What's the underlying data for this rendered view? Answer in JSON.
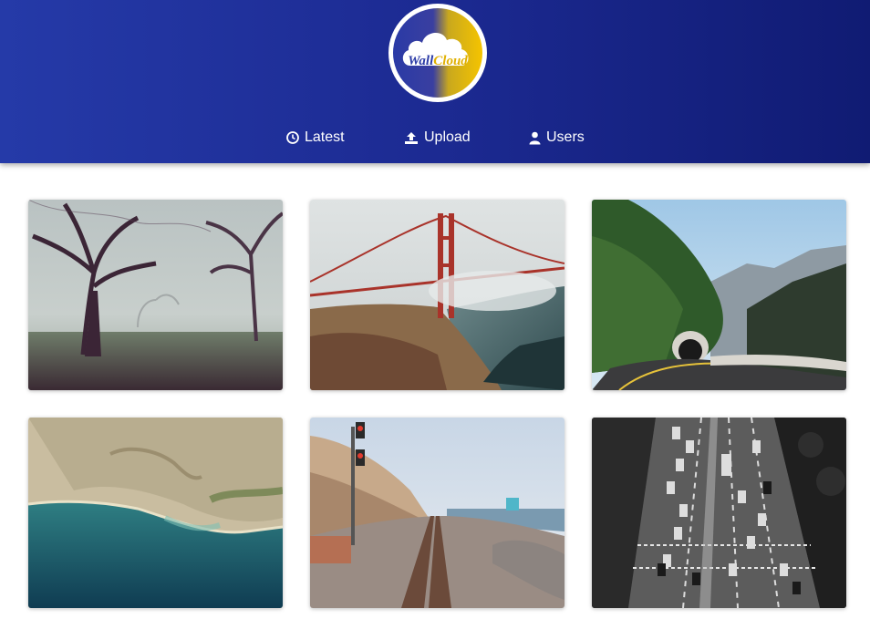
{
  "brand": {
    "name_part1": "Wall",
    "name_part2": "Cloud",
    "colors": {
      "header_start": "#253aa8",
      "header_end": "#101b73",
      "logo_blue": "#2a3aa6",
      "logo_gold": "#f5c400"
    }
  },
  "nav": {
    "items": [
      {
        "label": "Latest",
        "icon": "clock-icon"
      },
      {
        "label": "Upload",
        "icon": "upload-icon"
      },
      {
        "label": "Users",
        "icon": "user-icon"
      }
    ]
  },
  "gallery": {
    "items": [
      {
        "subject": "foggy-trees-photo"
      },
      {
        "subject": "golden-gate-bridge-photo"
      },
      {
        "subject": "mountain-road-tunnel-photo"
      },
      {
        "subject": "coastline-aerial-photo"
      },
      {
        "subject": "railroad-tracks-beach-photo"
      },
      {
        "subject": "highway-traffic-aerial-photo"
      }
    ]
  }
}
